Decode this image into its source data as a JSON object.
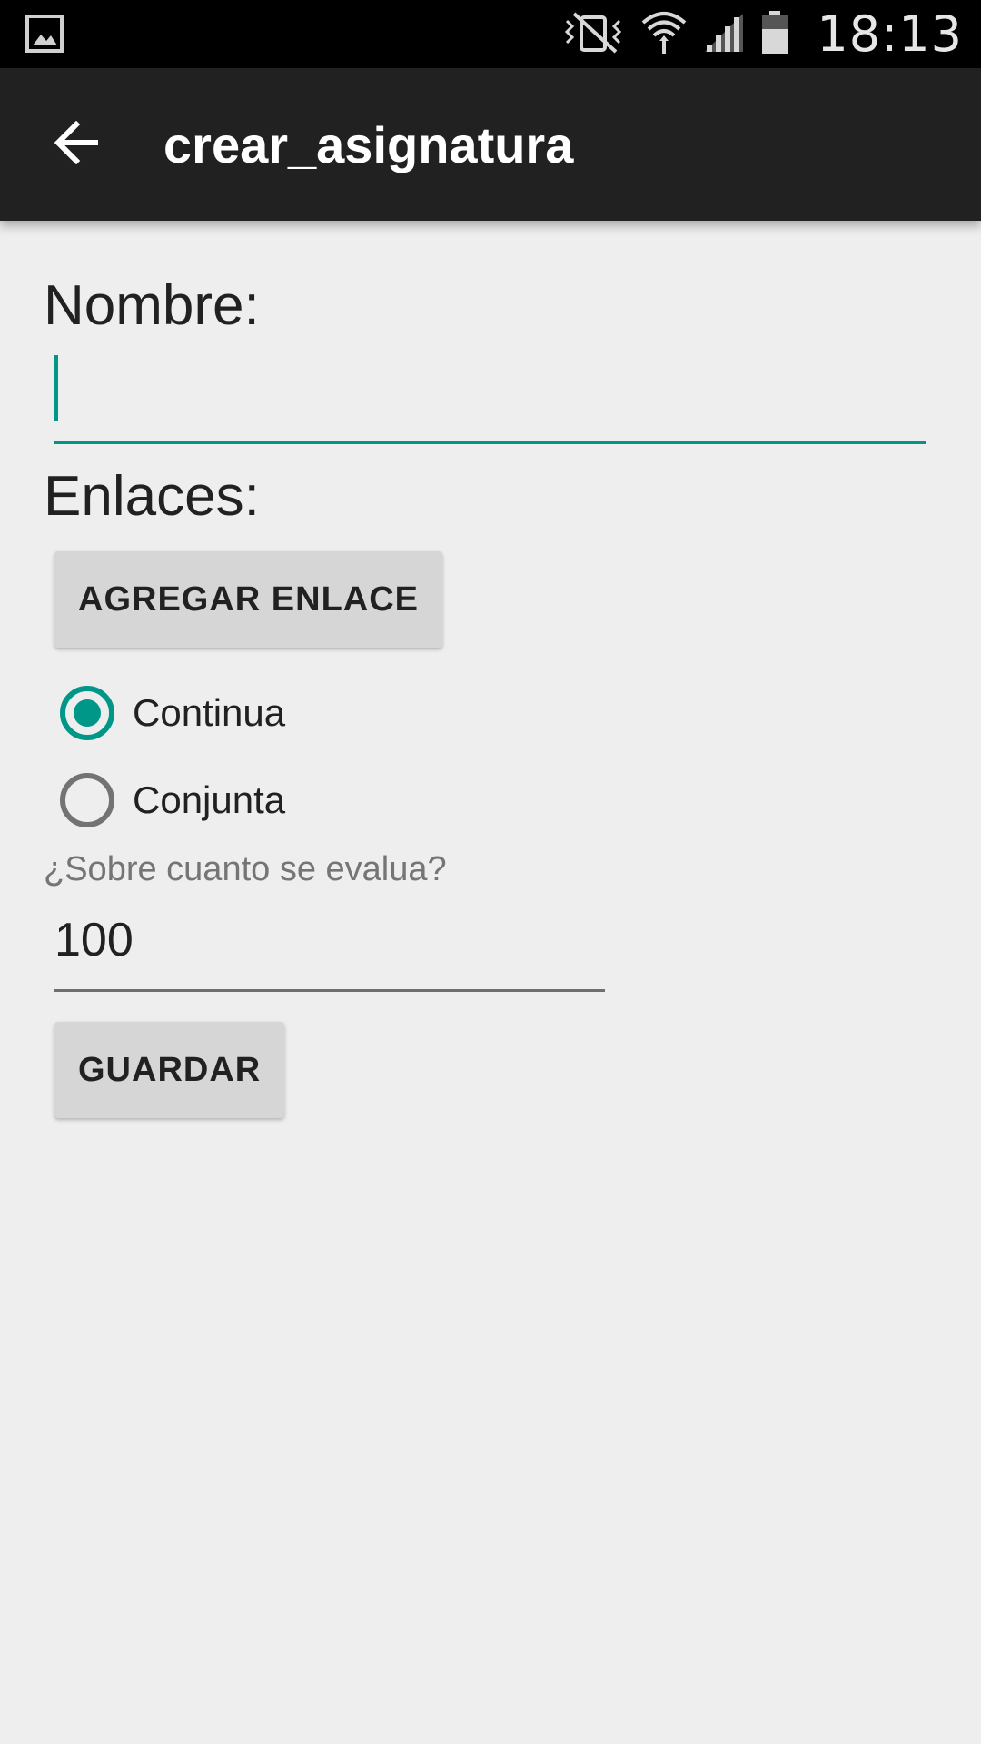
{
  "status_bar": {
    "time": "18:13",
    "icons": [
      "image-notification-icon",
      "vibrate-icon",
      "wifi-icon",
      "signal-icon",
      "battery-icon"
    ]
  },
  "app_bar": {
    "title": "crear_asignatura",
    "back_icon": "arrow-back-icon",
    "background": "#212121"
  },
  "form": {
    "name_label": "Nombre:",
    "name_value": "",
    "links_label": "Enlaces:",
    "add_link_button": "AGREGAR ENLACE",
    "evaluation_options": [
      {
        "label": "Continua",
        "checked": true
      },
      {
        "label": "Conjunta",
        "checked": false
      }
    ],
    "score_hint": "¿Sobre cuanto se evalua?",
    "score_value": "100",
    "save_button": "GUARDAR"
  },
  "colors": {
    "accent": "#009688",
    "background": "#eeeeee",
    "button": "#d6d6d6"
  }
}
